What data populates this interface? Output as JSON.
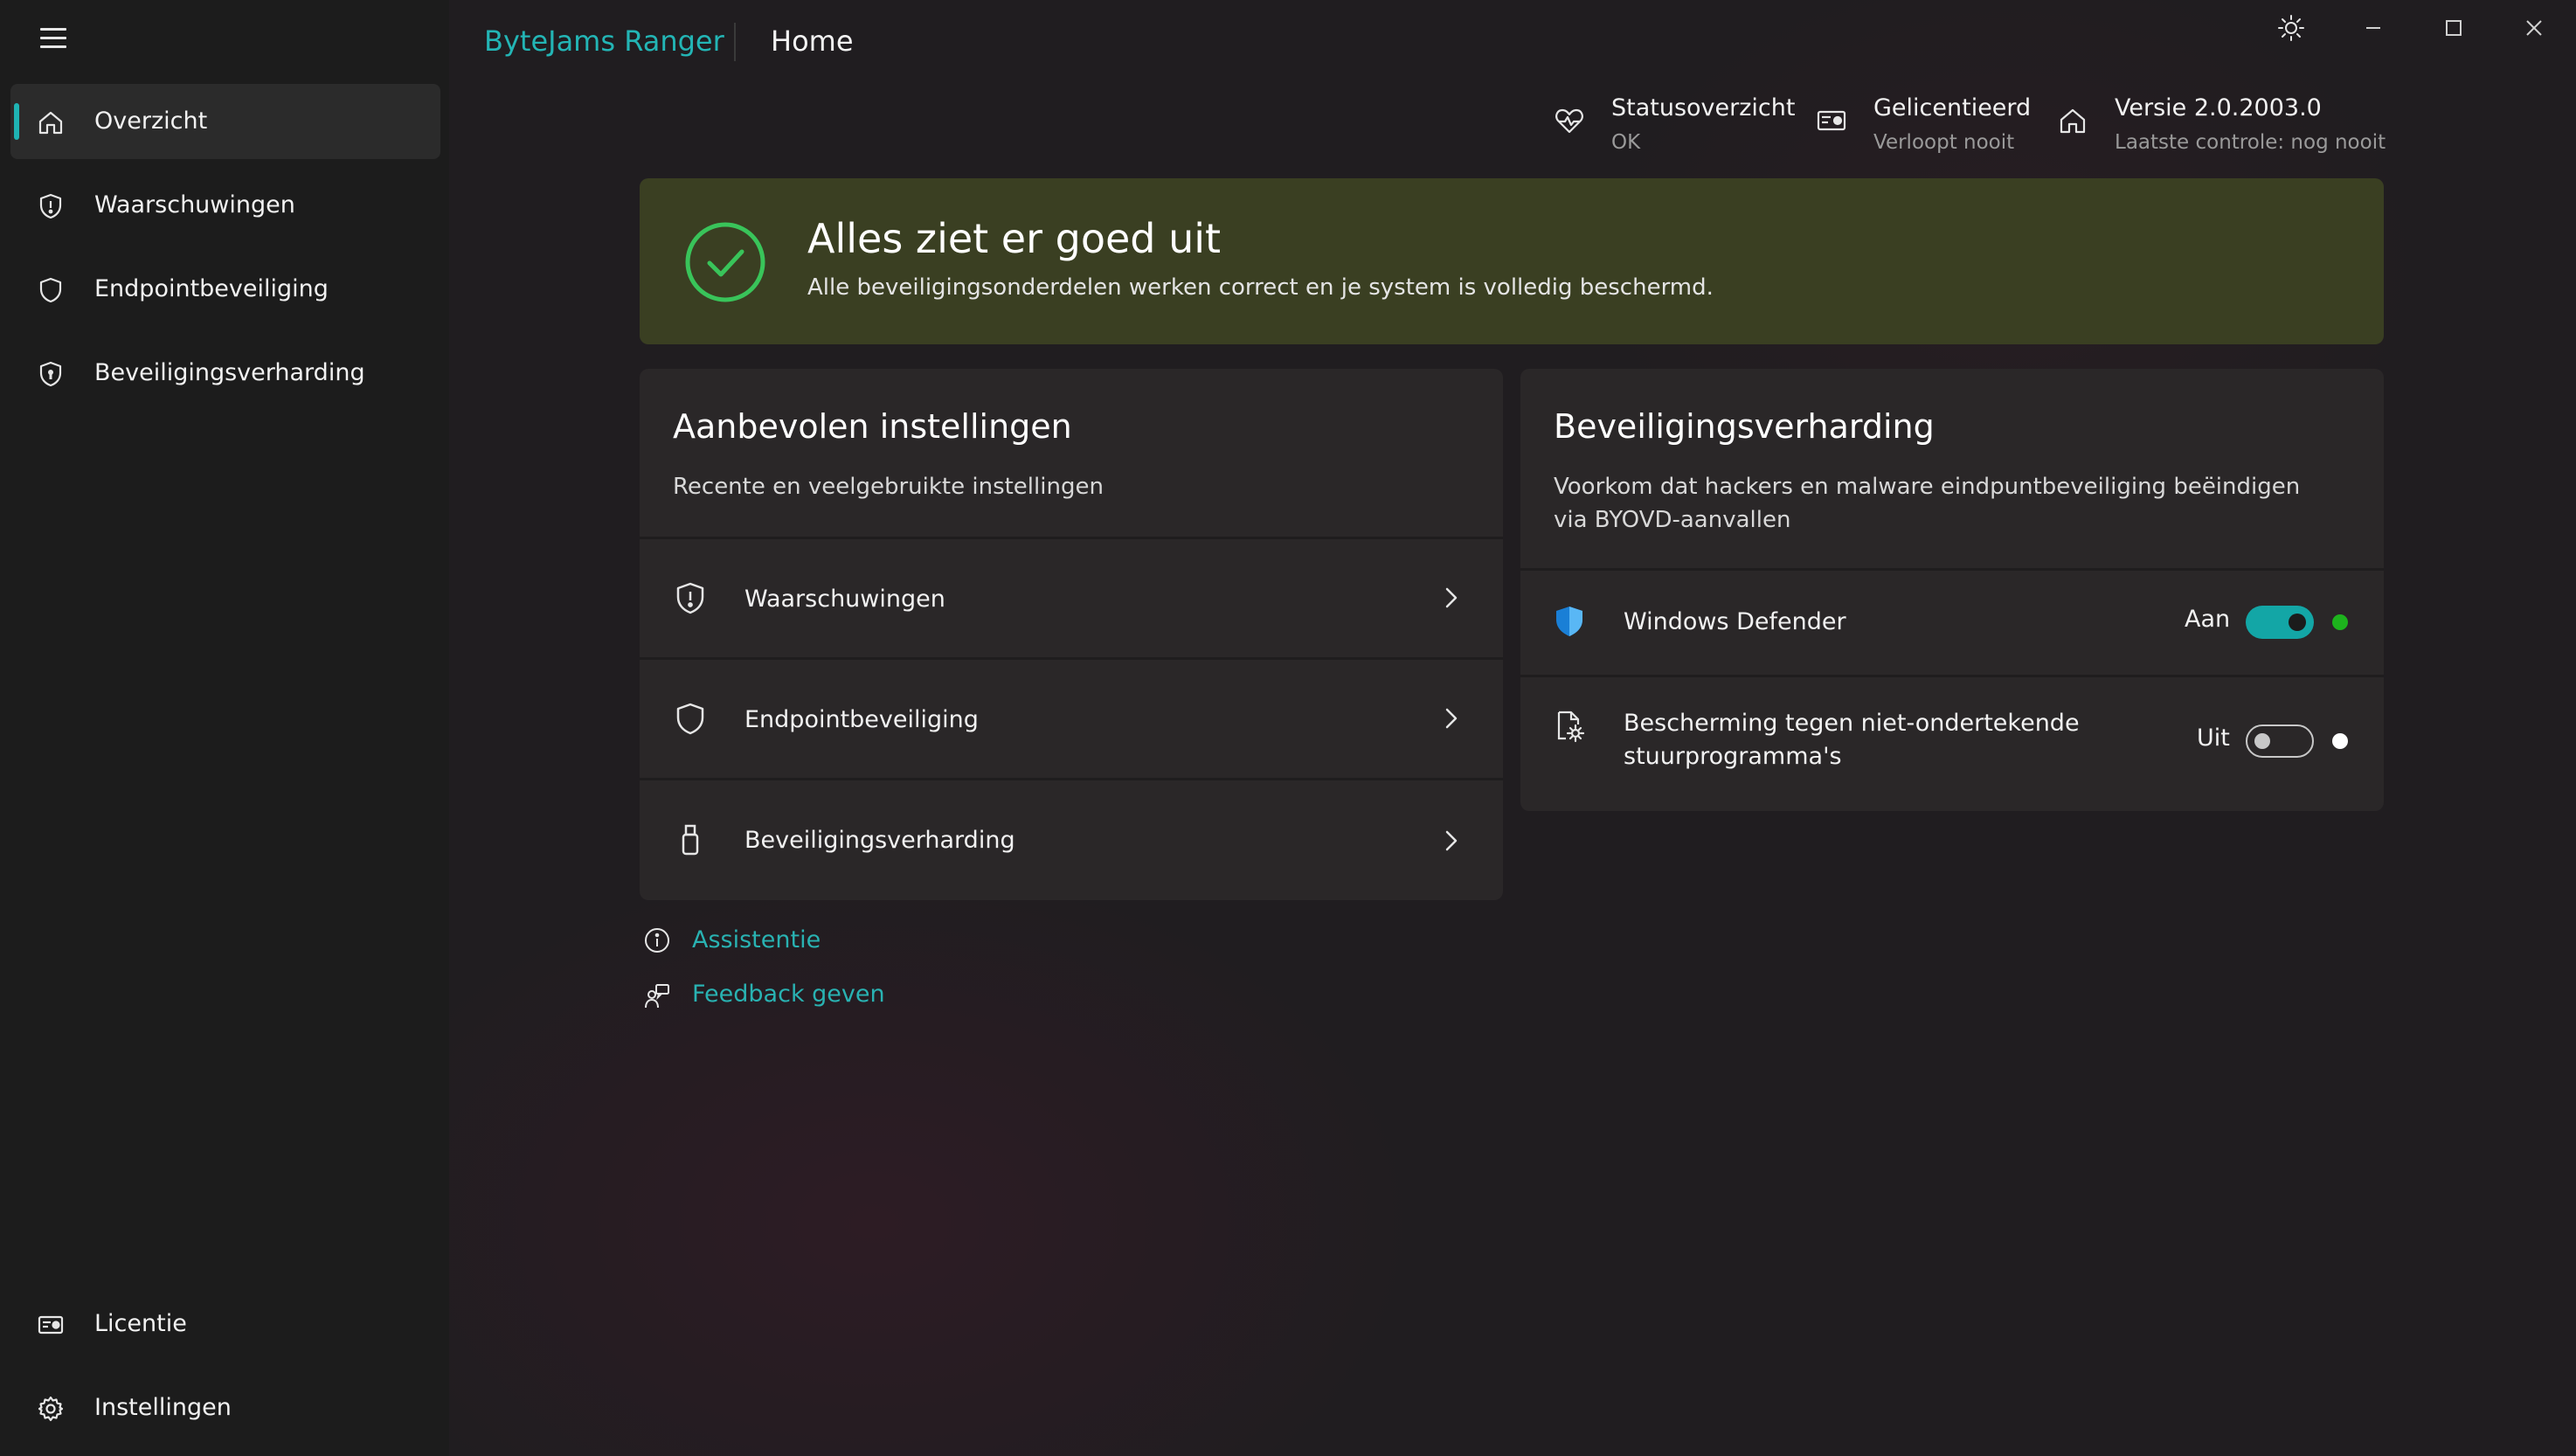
{
  "app": {
    "title": "ByteJams Ranger",
    "page_title": "Home",
    "accent": "#1fb4b4"
  },
  "window_controls": {
    "theme": "sun-icon",
    "minimize": "minimize-icon",
    "maximize": "maximize-icon",
    "close": "close-icon"
  },
  "sidebar": {
    "items": [
      {
        "label": "Overzicht",
        "icon": "home-icon",
        "active": true
      },
      {
        "label": "Waarschuwingen",
        "icon": "shield-alert-icon"
      },
      {
        "label": "Endpointbeveiliging",
        "icon": "shield-icon"
      },
      {
        "label": "Beveiligingsverharding",
        "icon": "shield-lock-icon"
      }
    ],
    "footer": [
      {
        "label": "Licentie",
        "icon": "license-icon"
      },
      {
        "label": "Instellingen",
        "icon": "gear-icon"
      }
    ]
  },
  "status": {
    "health": {
      "title": "Statusoverzicht",
      "sub": "OK",
      "icon": "heartbeat-icon"
    },
    "license": {
      "title": "Gelicentieerd",
      "sub": "Verloopt nooit",
      "icon": "license-icon"
    },
    "version": {
      "title": "Versie 2.0.2003.0",
      "sub": "Laatste controle: nog nooit",
      "icon": "home-icon"
    }
  },
  "banner": {
    "title": "Alles ziet er goed uit",
    "sub": "Alle beveiligingsonderdelen werken correct en je system is volledig beschermd.",
    "color": "#3a3f22",
    "icon": "check-circle-icon"
  },
  "recommended": {
    "title": "Aanbevolen instellingen",
    "sub": "Recente en veelgebruikte instellingen",
    "rows": [
      {
        "label": "Waarschuwingen",
        "icon": "shield-alert-icon"
      },
      {
        "label": "Endpointbeveiliging",
        "icon": "shield-icon"
      },
      {
        "label": "Beveiligingsverharding",
        "icon": "usb-drive-icon"
      }
    ]
  },
  "hardening": {
    "title": "Beveiligingsverharding",
    "sub": "Voorkom dat hackers en malware eindpuntbeveiliging beëindigen via BYOVD-aanvallen",
    "rows": [
      {
        "label": "Windows Defender",
        "state": "Aan",
        "on": true,
        "status_color": "#1db31d",
        "icon": "defender-shield-icon"
      },
      {
        "label": "Bescherming tegen niet-ondertekende stuurprogramma's",
        "state": "Uit",
        "on": false,
        "status_color": "#ffffff",
        "icon": "driver-gear-icon"
      }
    ]
  },
  "links": [
    {
      "label": "Assistentie",
      "icon": "info-icon"
    },
    {
      "label": "Feedback geven",
      "icon": "feedback-icon"
    }
  ]
}
